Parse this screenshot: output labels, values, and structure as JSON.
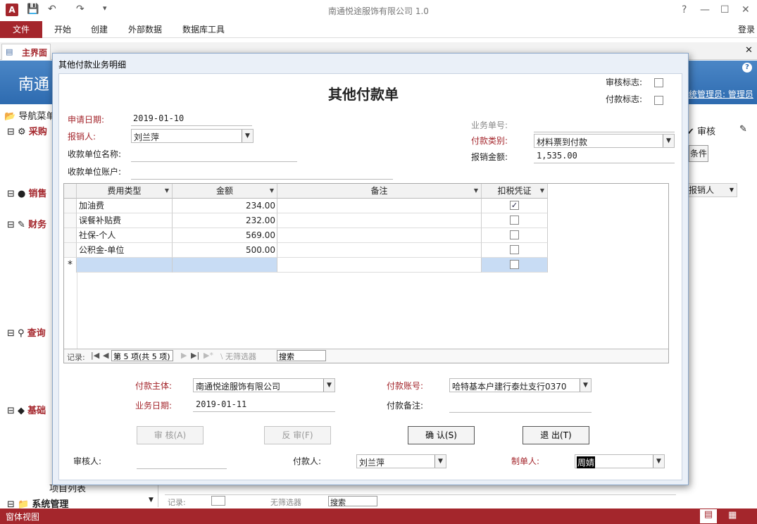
{
  "app": {
    "title": "南通悦途服饰有限公司 1.0",
    "logo": "A",
    "help": "?",
    "login": "登录"
  },
  "ribbon": {
    "file": "文件",
    "tabs": [
      "开始",
      "创建",
      "外部数据",
      "数据库工具"
    ]
  },
  "background": {
    "main_tab": "主界面",
    "banner_title": "南通",
    "user_info": "统管理员: 管理员",
    "nav": [
      "导航菜单",
      "采购",
      "销售",
      "财务",
      "查询",
      "基础",
      "项目列表",
      "系统管理"
    ],
    "audit_label": "审核",
    "condition_label": "条件",
    "col_reporter": "报销人",
    "nav_record": "记录:",
    "nav_nofilter": "无筛选器",
    "nav_search": "搜索"
  },
  "statusbar": {
    "text": "窗体视图"
  },
  "dialog": {
    "title": "其他付款业务明细",
    "form_title": "其他付款单",
    "audit_flag_label": "审核标志:",
    "pay_flag_label": "付款标志:",
    "audit_flag": false,
    "pay_flag": false,
    "apply_date_label": "申请日期:",
    "apply_date": "2019-01-10",
    "reporter_label": "报销人:",
    "reporter": "刘兰萍",
    "payee_name_label": "收款单位名称:",
    "payee_name": "",
    "payee_account_label": "收款单位账户:",
    "payee_account": "",
    "biz_no_label": "业务单号:",
    "biz_no": "",
    "pay_type_label": "付款类别:",
    "pay_type": "材料票到付款",
    "amount_label": "报销金额:",
    "amount": "1,535.00",
    "grid": {
      "columns": [
        "费用类型",
        "金额",
        "备注",
        "扣税凭证"
      ],
      "rows": [
        {
          "type": "加油费",
          "amount": "234.00",
          "note": "",
          "tax": true
        },
        {
          "type": "误餐补贴费",
          "amount": "232.00",
          "note": "",
          "tax": false
        },
        {
          "type": "社保-个人",
          "amount": "569.00",
          "note": "",
          "tax": false
        },
        {
          "type": "公积金-单位",
          "amount": "500.00",
          "note": "",
          "tax": false
        }
      ],
      "new_row_marker": "*",
      "nav": {
        "record_label": "记录:",
        "position": "第 5 项(共 5 项)",
        "no_filter": "无筛选器",
        "search": "搜索"
      }
    },
    "pay_entity_label": "付款主体:",
    "pay_entity": "南通悦途服饰有限公司",
    "biz_date_label": "业务日期:",
    "biz_date": "2019-01-11",
    "pay_account_label": "付款账号:",
    "pay_account": "哈特基本户建行泰灶支行0370",
    "pay_note_label": "付款备注:",
    "pay_note": "",
    "buttons": {
      "audit": "审 核(A)",
      "unaudit": "反 审(F)",
      "confirm": "确 认(S)",
      "exit": "退 出(T)"
    },
    "auditor_label": "审核人:",
    "auditor": "",
    "payer_label": "付款人:",
    "payer": "刘兰萍",
    "maker_label": "制单人:",
    "maker": "周婧"
  }
}
